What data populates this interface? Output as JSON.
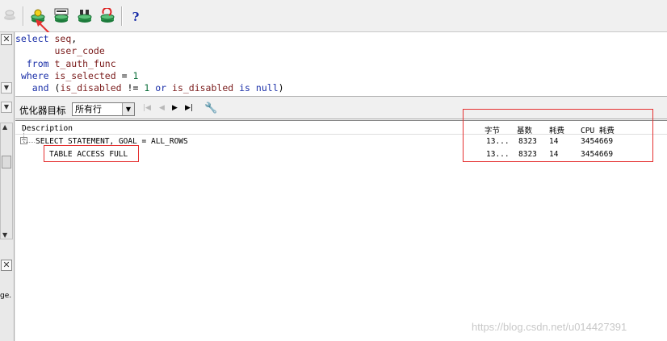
{
  "toolbar": {
    "buttons": [
      {
        "icon": "execute-plan-icon"
      },
      {
        "icon": "sql-icon"
      },
      {
        "icon": "tree-view-icon"
      },
      {
        "icon": "refresh-plan-icon"
      }
    ],
    "help_label": "?"
  },
  "editor": {
    "lines": [
      {
        "indent": "",
        "kw": "select",
        "rest": " seq,"
      },
      {
        "indent": "       ",
        "kw": "",
        "rest": "user_code"
      },
      {
        "indent": "  ",
        "kw": "from",
        "rest": " t_auth_func"
      },
      {
        "indent": " ",
        "kw": "where",
        "rest": " is_selected = 1"
      },
      {
        "indent": "   ",
        "kw": "and",
        "rest": " (is_disabled != 1 or is_disabled is null)"
      }
    ]
  },
  "optimizer": {
    "label": "优化器目标",
    "selected": "所有行"
  },
  "plan": {
    "headers": {
      "description": "Description",
      "bytes": "字节",
      "cardinality": "基数",
      "cost": "耗费",
      "cpu_cost": "CPU 耗费"
    },
    "rows": [
      {
        "description": "SELECT STATEMENT, GOAL = ALL_ROWS",
        "bytes": "13...",
        "cardinality": "8323",
        "cost": "14",
        "cpu_cost": "3454669"
      },
      {
        "description": "TABLE ACCESS FULL",
        "bytes": "13...",
        "cardinality": "8323",
        "cost": "14",
        "cpu_cost": "3454669"
      }
    ]
  },
  "gutter": {
    "truncated_text": "ge."
  },
  "watermark": "https://blog.csdn.net/u014427391",
  "colors": {
    "keyword": "#1a2fa8",
    "identifier": "#7a1b1b",
    "number": "#0b6e3a",
    "annotation": "#e53030"
  }
}
